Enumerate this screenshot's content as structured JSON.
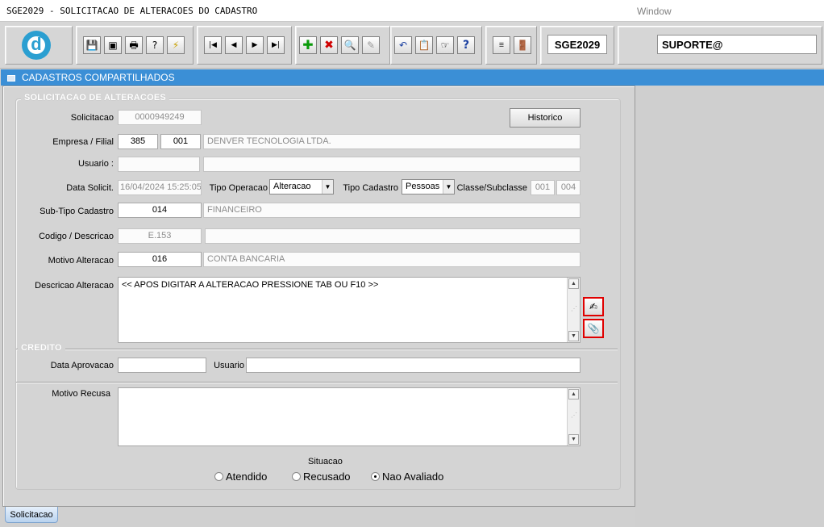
{
  "window": {
    "title": "SGE2029 - SOLICITACAO DE ALTERACOES DO CADASTRO",
    "menu": "Window"
  },
  "toolbar": {
    "module_code": "SGE2029",
    "user": "SUPORTE@",
    "logo_letter": "d",
    "icons": [
      "save-icon",
      "window-icon",
      "print-icon",
      "help-query-icon",
      "lightning-query-icon",
      "first-record-icon",
      "previous-record-icon",
      "next-record-icon",
      "last-record-icon",
      "add-record-icon",
      "delete-record-icon",
      "search-record-icon",
      "clear-record-icon",
      "undo-icon",
      "copy-icon",
      "edit-hand-icon",
      "help-icon",
      "menu-icon",
      "exit-door-icon"
    ]
  },
  "header": {
    "title": "CADASTROS COMPARTILHADOS"
  },
  "solicitacao": {
    "section_title": "SOLICITACAO DE ALTERACOES",
    "labels": {
      "solicitacao": "Solicitacao",
      "empresa_filial": "Empresa / Filial",
      "usuario": "Usuario :",
      "data_solicit": "Data Solicit.",
      "tipo_operacao": "Tipo Operacao",
      "tipo_cadastro": "Tipo Cadastro",
      "classe_subclasse": "Classe/Subclasse",
      "sub_tipo_cadastro": "Sub-Tipo Cadastro",
      "codigo_descricao": "Codigo / Descricao",
      "motivo_alteracao": "Motivo Alteracao",
      "descricao_alteracao": "Descricao Alteracao"
    },
    "historico_button": "Historico",
    "values": {
      "solicitacao": "0000949249",
      "empresa": "385",
      "filial": "001",
      "empresa_nome": "DENVER TECNOLOGIA LTDA.",
      "usuario_codigo": "",
      "usuario_nome": "",
      "data_solicit": "16/04/2024 15:25:05",
      "tipo_operacao": "Alteracao",
      "tipo_cadastro": "Pessoas",
      "classe": "001",
      "subclasse": "004",
      "sub_tipo_codigo": "014",
      "sub_tipo_nome": "FINANCEIRO",
      "codigo": "E.153",
      "descricao": "",
      "motivo_codigo": "016",
      "motivo_nome": "CONTA BANCARIA",
      "descricao_alteracao": "<< APOS DIGITAR A ALTERACAO PRESSIONE TAB OU F10 >>"
    }
  },
  "credito": {
    "section_title": "CREDITO",
    "labels": {
      "data_aprovacao": "Data Aprovacao",
      "usuario": "Usuario",
      "motivo_recusa": "Motivo Recusa"
    },
    "values": {
      "data_aprovacao": "",
      "usuario": "",
      "motivo_recusa": ""
    }
  },
  "situacao": {
    "label": "Situacao",
    "options": [
      "Atendido",
      "Recusado",
      "Nao Avaliado"
    ],
    "selected": "Nao Avaliado"
  },
  "tabs": [
    {
      "label": "Solicitacao",
      "active": true
    }
  ]
}
